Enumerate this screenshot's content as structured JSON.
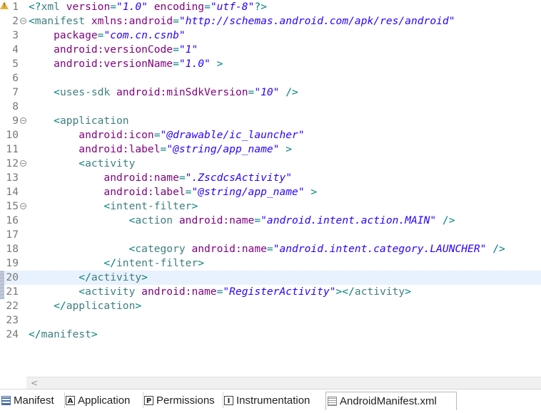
{
  "editor": {
    "current_line": 20,
    "lines": [
      {
        "n": "1",
        "parts": [
          [
            "punc",
            "<?"
          ],
          [
            "tag",
            "xml "
          ],
          [
            "attr",
            "version"
          ],
          [
            "punc",
            "="
          ],
          [
            "val",
            "\"1.0\""
          ],
          [
            "attr",
            " encoding"
          ],
          [
            "punc",
            "="
          ],
          [
            "val",
            "\"utf-8\""
          ],
          [
            "punc",
            "?>"
          ]
        ]
      },
      {
        "n": "2",
        "parts": [
          [
            "punc",
            "<"
          ],
          [
            "tag",
            "manifest "
          ],
          [
            "attr",
            "xmlns:android"
          ],
          [
            "punc",
            "="
          ],
          [
            "val",
            "\"http://schemas.android.com/apk/res/android\""
          ]
        ]
      },
      {
        "n": "3",
        "parts": [
          [
            "attr",
            "    package"
          ],
          [
            "punc",
            "="
          ],
          [
            "val",
            "\"com.cn.csnb\""
          ]
        ]
      },
      {
        "n": "4",
        "parts": [
          [
            "attr",
            "    android:versionCode"
          ],
          [
            "punc",
            "="
          ],
          [
            "val",
            "\"1\""
          ]
        ]
      },
      {
        "n": "5",
        "parts": [
          [
            "attr",
            "    android:versionName"
          ],
          [
            "punc",
            "="
          ],
          [
            "val",
            "\"1.0\""
          ],
          [
            "punc",
            " >"
          ]
        ]
      },
      {
        "n": "6",
        "parts": []
      },
      {
        "n": "7",
        "parts": [
          [
            "punc",
            "    <"
          ],
          [
            "tag",
            "uses-sdk "
          ],
          [
            "attr",
            "android:minSdkVersion"
          ],
          [
            "punc",
            "="
          ],
          [
            "val",
            "\"10\""
          ],
          [
            "punc",
            " />"
          ]
        ]
      },
      {
        "n": "8",
        "parts": []
      },
      {
        "n": "9",
        "parts": [
          [
            "punc",
            "    <"
          ],
          [
            "tag",
            "application"
          ]
        ]
      },
      {
        "n": "10",
        "parts": [
          [
            "attr",
            "        android:icon"
          ],
          [
            "punc",
            "="
          ],
          [
            "val",
            "\"@drawable/ic_launcher\""
          ]
        ]
      },
      {
        "n": "11",
        "parts": [
          [
            "attr",
            "        android:label"
          ],
          [
            "punc",
            "="
          ],
          [
            "val",
            "\"@string/app_name\""
          ],
          [
            "punc",
            " >"
          ]
        ]
      },
      {
        "n": "12",
        "parts": [
          [
            "punc",
            "        <"
          ],
          [
            "tag",
            "activity"
          ]
        ]
      },
      {
        "n": "13",
        "parts": [
          [
            "attr",
            "            android:name"
          ],
          [
            "punc",
            "="
          ],
          [
            "val",
            "\".ZscdcsActivity\""
          ]
        ]
      },
      {
        "n": "14",
        "parts": [
          [
            "attr",
            "            android:label"
          ],
          [
            "punc",
            "="
          ],
          [
            "val",
            "\"@string/app_name\""
          ],
          [
            "punc",
            " >"
          ]
        ]
      },
      {
        "n": "15",
        "parts": [
          [
            "punc",
            "            <"
          ],
          [
            "tag",
            "intent-filter"
          ],
          [
            "punc",
            ">"
          ]
        ]
      },
      {
        "n": "16",
        "parts": [
          [
            "punc",
            "                <"
          ],
          [
            "tag",
            "action "
          ],
          [
            "attr",
            "android:name"
          ],
          [
            "punc",
            "="
          ],
          [
            "val",
            "\"android.intent.action.MAIN\""
          ],
          [
            "punc",
            " />"
          ]
        ]
      },
      {
        "n": "17",
        "parts": []
      },
      {
        "n": "18",
        "parts": [
          [
            "punc",
            "                <"
          ],
          [
            "tag",
            "category "
          ],
          [
            "attr",
            "android:name"
          ],
          [
            "punc",
            "="
          ],
          [
            "val",
            "\"android.intent.category.LAUNCHER\""
          ],
          [
            "punc",
            " />"
          ]
        ]
      },
      {
        "n": "19",
        "parts": [
          [
            "punc",
            "            </"
          ],
          [
            "tag",
            "intent-filter"
          ],
          [
            "punc",
            ">"
          ]
        ]
      },
      {
        "n": "20",
        "parts": [
          [
            "punc",
            "        </"
          ],
          [
            "tag",
            "activity"
          ],
          [
            "punc",
            ">"
          ]
        ]
      },
      {
        "n": "21",
        "parts": [
          [
            "punc",
            "        <"
          ],
          [
            "tag",
            "activity "
          ],
          [
            "attr",
            "android:name"
          ],
          [
            "punc",
            "="
          ],
          [
            "val",
            "\"RegisterActivity\""
          ],
          [
            "punc",
            ">"
          ],
          [
            "punc",
            "</"
          ],
          [
            "tag",
            "activity"
          ],
          [
            "punc",
            ">"
          ]
        ]
      },
      {
        "n": "22",
        "parts": [
          [
            "punc",
            "    </"
          ],
          [
            "tag",
            "application"
          ],
          [
            "punc",
            ">"
          ]
        ]
      },
      {
        "n": "23",
        "parts": []
      },
      {
        "n": "24",
        "parts": [
          [
            "punc",
            "</"
          ],
          [
            "tag",
            "manifest"
          ],
          [
            "punc",
            ">"
          ]
        ]
      }
    ],
    "fold_markers": [
      "2",
      "9",
      "12",
      "15"
    ],
    "warning_line": "1",
    "change_marked_lines": [
      "20",
      "21"
    ]
  },
  "tabs": [
    {
      "label": "Manifest",
      "icon": "manifest-icon",
      "glyph": ""
    },
    {
      "label": "Application",
      "icon": "application-icon",
      "glyph": "A"
    },
    {
      "label": "Permissions",
      "icon": "permissions-icon",
      "glyph": "P"
    },
    {
      "label": "Instrumentation",
      "icon": "instrumentation-icon",
      "glyph": "I"
    },
    {
      "label": "AndroidManifest.xml",
      "icon": "xml-file-icon",
      "glyph": "",
      "active": true
    }
  ],
  "scrollbar": {
    "left_arrow": "<"
  }
}
